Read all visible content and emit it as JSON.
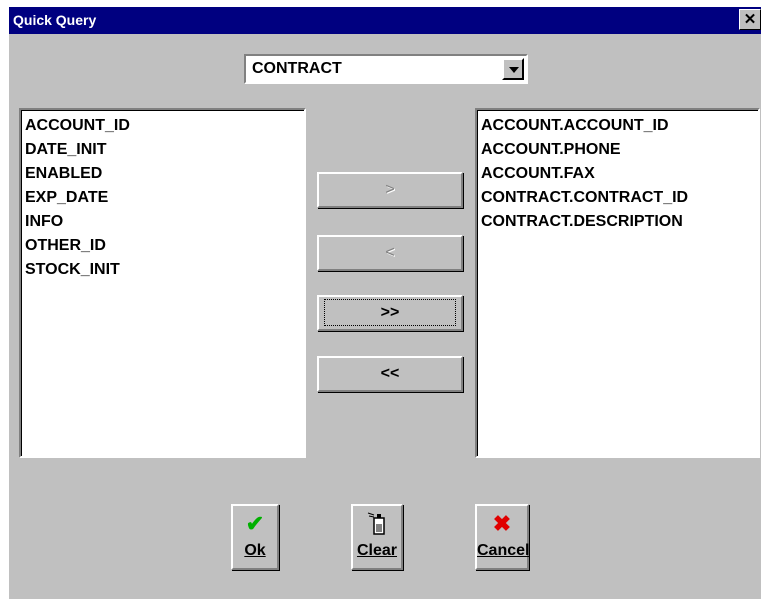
{
  "window": {
    "title": "Quick Query",
    "close_glyph": "✕"
  },
  "table_select": {
    "value": "CONTRACT"
  },
  "available_fields": [
    "ACCOUNT_ID",
    "DATE_INIT",
    "ENABLED",
    "EXP_DATE",
    "INFO",
    "OTHER_ID",
    "STOCK_INIT"
  ],
  "selected_fields": [
    "ACCOUNT.ACCOUNT_ID",
    "ACCOUNT.PHONE",
    "ACCOUNT.FAX",
    "CONTRACT.CONTRACT_ID",
    "CONTRACT.DESCRIPTION"
  ],
  "transfer_buttons": {
    "add": ">",
    "remove": "<",
    "add_all": ">>",
    "remove_all": "<<"
  },
  "actions": {
    "ok": {
      "label": "Ok",
      "icon": "checkmark-icon"
    },
    "clear": {
      "label": "Clear",
      "icon": "eraser-icon"
    },
    "cancel": {
      "label": "Cancel",
      "icon": "x-icon"
    }
  },
  "colors": {
    "titlebar": "#000080",
    "face": "#c0c0c0",
    "ok_icon": "#00b000",
    "cancel_icon": "#e00000"
  }
}
